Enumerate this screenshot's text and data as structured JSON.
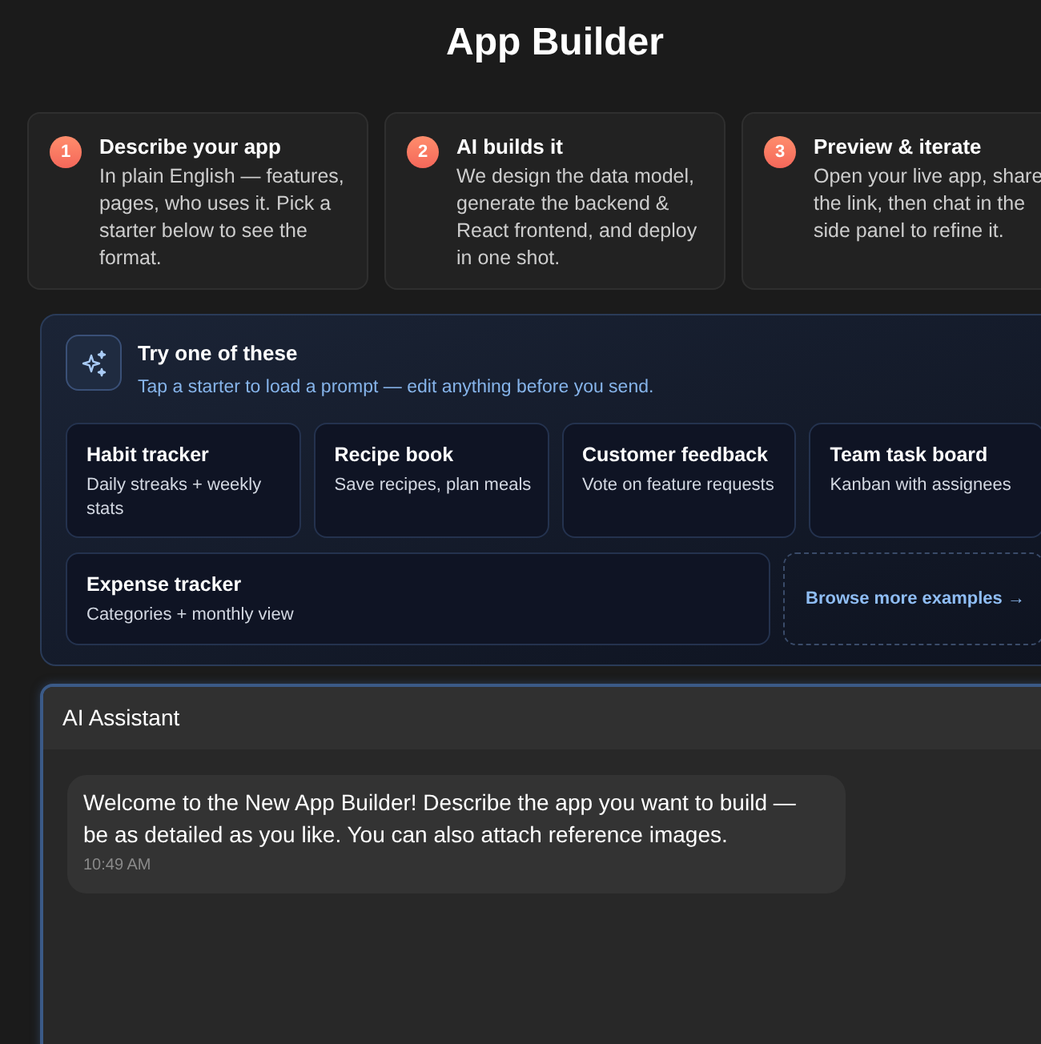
{
  "title": "App Builder",
  "steps": [
    {
      "number": "1",
      "title": "Describe your app",
      "description": "In plain English — features, pages, who uses it. Pick a starter below to see the format."
    },
    {
      "number": "2",
      "title": "AI builds it",
      "description": "We design the data model, generate the backend & React frontend, and deploy in one shot."
    },
    {
      "number": "3",
      "title": "Preview & iterate",
      "description": "Open your live app, share the link, then chat in the side panel to refine it."
    }
  ],
  "starters_panel": {
    "title": "Try one of these",
    "subtitle": "Tap a starter to load a prompt — edit anything before you send.",
    "starters": [
      {
        "title": "Habit tracker",
        "description": "Daily streaks + weekly stats"
      },
      {
        "title": "Recipe book",
        "description": "Save recipes, plan meals"
      },
      {
        "title": "Customer feedback",
        "description": "Vote on feature requests"
      },
      {
        "title": "Team task board",
        "description": "Kanban with assignees"
      },
      {
        "title": "Expense tracker",
        "description": "Categories + monthly view"
      }
    ],
    "browse_link": "Browse more examples →"
  },
  "chat": {
    "title": "AI Assistant",
    "messages": [
      {
        "text": "Welcome to the New App Builder! Describe the app you want to build — be as detailed as you like. You can also attach reference images.",
        "time": "10:49 AM"
      }
    ]
  }
}
